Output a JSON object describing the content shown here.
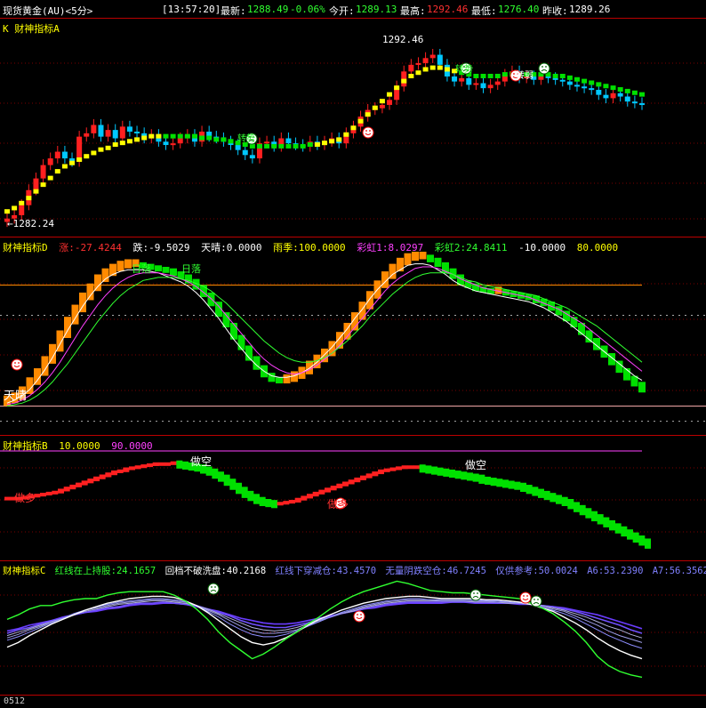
{
  "topbar": {
    "instrument": "现货黄金(AU)<5分>",
    "time": "[13:57:20]",
    "last_label": "最新:",
    "last_value": "1288.49",
    "change": "-0.06%",
    "open_label": "今开:",
    "open_value": "1289.13",
    "high_label": "最高:",
    "high_value": "1292.46",
    "low_label": "最低:",
    "low_value": "1276.40",
    "prev_label": "昨收:",
    "prev_value": "1289.26"
  },
  "pane_a": {
    "title": "K  财神指标A",
    "high_marker": "1292.46",
    "low_marker": "←1282.24",
    "signal_labels": [
      "转势",
      "转势",
      "转势",
      "转弱"
    ]
  },
  "pane_d": {
    "title": "财神指标D",
    "params": [
      {
        "text": "涨:-27.4244",
        "color": "#ff3030"
      },
      {
        "text": "跌:-9.5029",
        "color": "#ffffff"
      },
      {
        "text": "天晴:0.0000",
        "color": "#ffffff"
      },
      {
        "text": "雨季:100.0000",
        "color": "#ffff00"
      },
      {
        "text": "彩虹1:8.0297",
        "color": "#ff40ff"
      },
      {
        "text": "彩虹2:24.8411",
        "color": "#30ff30"
      },
      {
        "text": "-10.0000",
        "color": "#ffffff"
      },
      {
        "text": "80.0000",
        "color": "#ffff00"
      }
    ],
    "label_sunny": "天晴",
    "label_rain": "日落",
    "label_rain2": "日落"
  },
  "pane_b": {
    "title": "财神指标B",
    "params": [
      {
        "text": "10.0000",
        "color": "#ffff00"
      },
      {
        "text": "90.0000",
        "color": "#ff40ff"
      }
    ],
    "label_long": "做多",
    "label_short": "做空"
  },
  "pane_c": {
    "title": "财神指标C",
    "params": [
      {
        "text": "红线在上持股:24.1657",
        "color": "#30ff30"
      },
      {
        "text": "回档不破洗盘:40.2168",
        "color": "#ffffff"
      },
      {
        "text": "红线下穿减仓:43.4570",
        "color": "#8080ff"
      },
      {
        "text": "无量阴跌空仓:46.7245",
        "color": "#8080ff"
      },
      {
        "text": "仅供参考:50.0024",
        "color": "#8080ff"
      },
      {
        "text": "A6:53.2390",
        "color": "#8080ff"
      },
      {
        "text": "A7:56.3562",
        "color": "#8080ff"
      }
    ]
  },
  "bottom": {
    "code": "0512"
  },
  "colors": {
    "up": "#ff2020",
    "down": "#00c8ff",
    "yellow": "#ffff00",
    "green": "#00e000",
    "orange": "#ff8a00",
    "magenta": "#ff40ff",
    "purple": "#8040ff"
  },
  "chart_data": [
    {
      "type": "candlestick",
      "title": "K  财神指标A",
      "close": [
        1282.4,
        1282.6,
        1283.2,
        1284.1,
        1284.8,
        1285.6,
        1286.0,
        1286.4,
        1286.0,
        1285.8,
        1287.3,
        1287.5,
        1288.0,
        1287.3,
        1287.7,
        1287.2,
        1287.9,
        1287.6,
        1287.5,
        1287.2,
        1287.4,
        1287.0,
        1286.8,
        1286.9,
        1287.2,
        1287.4,
        1287.0,
        1287.6,
        1287.3,
        1287.2,
        1287.0,
        1286.8,
        1286.5,
        1286.2,
        1286.0,
        1286.9,
        1287.0,
        1286.7,
        1287.2,
        1286.9,
        1286.8,
        1286.7,
        1287.0,
        1286.8,
        1287.0,
        1287.2,
        1286.9,
        1287.5,
        1287.9,
        1288.5,
        1288.9,
        1289.0,
        1289.2,
        1289.5,
        1290.3,
        1291.2,
        1291.6,
        1291.7,
        1292.0,
        1292.2,
        1291.6,
        1290.9,
        1290.6,
        1290.8,
        1290.4,
        1290.5,
        1290.2,
        1290.4,
        1290.6,
        1291.0,
        1291.2,
        1290.8,
        1290.9,
        1290.7,
        1291.0,
        1290.8,
        1290.7,
        1290.6,
        1290.4,
        1290.3,
        1290.2,
        1290.1,
        1289.8,
        1289.6,
        1289.9,
        1289.7,
        1289.4,
        1289.3,
        1289.2
      ],
      "trail": [
        1282.8,
        1283.0,
        1283.3,
        1283.6,
        1284.0,
        1284.4,
        1284.8,
        1285.2,
        1285.5,
        1285.7,
        1285.9,
        1286.1,
        1286.3,
        1286.5,
        1286.6,
        1286.8,
        1286.9,
        1287.0,
        1287.1,
        1287.2,
        1287.3,
        1287.3,
        1287.3,
        1287.3,
        1287.3,
        1287.3,
        1287.3,
        1287.2,
        1287.2,
        1287.1,
        1287.1,
        1287.0,
        1286.9,
        1286.8,
        1286.7,
        1286.7,
        1286.7,
        1286.7,
        1286.7,
        1286.7,
        1286.7,
        1286.7,
        1286.8,
        1286.8,
        1286.9,
        1287.0,
        1287.1,
        1287.4,
        1287.8,
        1288.2,
        1288.6,
        1289.0,
        1289.4,
        1289.8,
        1290.2,
        1290.6,
        1290.9,
        1291.1,
        1291.3,
        1291.4,
        1291.4,
        1291.3,
        1291.2,
        1291.1,
        1291.0,
        1290.9,
        1290.9,
        1290.9,
        1290.9,
        1291.0,
        1291.0,
        1291.0,
        1291.0,
        1291.0,
        1291.0,
        1291.0,
        1290.9,
        1290.9,
        1290.8,
        1290.7,
        1290.6,
        1290.5,
        1290.4,
        1290.3,
        1290.2,
        1290.1,
        1290.0,
        1289.9,
        1289.8
      ],
      "ylim": [
        1281.8,
        1293.4
      ],
      "high_marker": 1292.46,
      "low_marker": 1282.24
    },
    {
      "type": "bar",
      "title": "财神指标D",
      "values": [
        2,
        4,
        8,
        14,
        20,
        28,
        36,
        45,
        54,
        62,
        70,
        76,
        82,
        86,
        89,
        91,
        92,
        92,
        91,
        90,
        89,
        88,
        86,
        84,
        81,
        77,
        72,
        66,
        59,
        52,
        44,
        37,
        30,
        24,
        19,
        16,
        15,
        16,
        18,
        21,
        25,
        29,
        33,
        38,
        44,
        50,
        57,
        64,
        71,
        78,
        84,
        89,
        93,
        96,
        97,
        97,
        95,
        92,
        88,
        84,
        80,
        78,
        76,
        75,
        74,
        74,
        73,
        72,
        71,
        70,
        68,
        66,
        63,
        60,
        56,
        52,
        47,
        42,
        37,
        32,
        27,
        22,
        17,
        13,
        9
      ],
      "line1": [
        2,
        4,
        7,
        11,
        17,
        24,
        32,
        41,
        50,
        58,
        66,
        73,
        79,
        84,
        87,
        89,
        90,
        90,
        90,
        89,
        88,
        86,
        84,
        82,
        79,
        75,
        70,
        64,
        58,
        51,
        44,
        38,
        32,
        27,
        23,
        20,
        19,
        19,
        20,
        22,
        25,
        29,
        34,
        39,
        45,
        51,
        58,
        64,
        71,
        77,
        82,
        87,
        90,
        93,
        94,
        94,
        93,
        90,
        87,
        83,
        80,
        78,
        76,
        75,
        74,
        73,
        72,
        71,
        70,
        69,
        67,
        65,
        62,
        59,
        56,
        52,
        48,
        44,
        40,
        36,
        32,
        28,
        24,
        20,
        17
      ],
      "line2": [
        1,
        2,
        4,
        7,
        11,
        16,
        22,
        29,
        37,
        45,
        53,
        60,
        67,
        73,
        78,
        82,
        85,
        87,
        88,
        88,
        88,
        87,
        86,
        84,
        82,
        79,
        75,
        71,
        66,
        60,
        54,
        48,
        42,
        36,
        31,
        27,
        24,
        22,
        21,
        22,
        24,
        27,
        31,
        35,
        40,
        46,
        52,
        58,
        64,
        70,
        76,
        81,
        85,
        88,
        91,
        92,
        92,
        91,
        89,
        87,
        84,
        82,
        80,
        78,
        77,
        76,
        75,
        74,
        73,
        72,
        70,
        68,
        66,
        64,
        61,
        58,
        55,
        51,
        47,
        43,
        39,
        35,
        31,
        27,
        23
      ],
      "line3": [
        0,
        1,
        2,
        4,
        7,
        11,
        16,
        22,
        28,
        35,
        42,
        49,
        56,
        62,
        68,
        73,
        77,
        80,
        83,
        84,
        85,
        85,
        85,
        84,
        83,
        81,
        79,
        76,
        72,
        68,
        63,
        58,
        53,
        48,
        43,
        39,
        35,
        32,
        30,
        29,
        29,
        30,
        32,
        35,
        39,
        43,
        48,
        53,
        59,
        64,
        69,
        74,
        78,
        82,
        85,
        87,
        88,
        88,
        88,
        87,
        85,
        83,
        82,
        80,
        79,
        78,
        77,
        76,
        75,
        74,
        73,
        71,
        69,
        67,
        65,
        62,
        59,
        56,
        53,
        49,
        45,
        41,
        37,
        33,
        29
      ],
      "ylim": [
        -12,
        102
      ],
      "ref_lines": [
        0,
        80,
        100,
        -10
      ]
    },
    {
      "type": "bar",
      "title": "财神指标B",
      "values": [
        53,
        53,
        53,
        54,
        55,
        56,
        57,
        58,
        59,
        61,
        63,
        65,
        67,
        69,
        71,
        73,
        75,
        77,
        79,
        80,
        82,
        83,
        84,
        85,
        86,
        87,
        87,
        87,
        88,
        87,
        86,
        85,
        84,
        82,
        80,
        77,
        74,
        70,
        66,
        62,
        58,
        55,
        52,
        50,
        49,
        48,
        48,
        49,
        50,
        52,
        54,
        56,
        58,
        60,
        62,
        64,
        66,
        68,
        70,
        72,
        74,
        76,
        78,
        80,
        81,
        82,
        83,
        84,
        84,
        84,
        83,
        82,
        81,
        80,
        79,
        78,
        77,
        76,
        75,
        74,
        72,
        71,
        70,
        69,
        68,
        67,
        66,
        64,
        62,
        60,
        58,
        56,
        54,
        52,
        50,
        47,
        44,
        41,
        38,
        35,
        32,
        29,
        26,
        23,
        20,
        17,
        14,
        11,
        8
      ],
      "ylim": [
        0,
        100
      ],
      "ref_lines": [
        10,
        90
      ]
    },
    {
      "type": "line",
      "title": "财神指标C",
      "series": [
        {
          "name": "红线在上持股",
          "values": [
            62,
            66,
            71,
            74,
            74,
            77,
            79,
            80,
            80,
            83,
            85,
            86,
            86,
            86,
            86,
            83,
            78,
            71,
            62,
            51,
            42,
            35,
            28,
            32,
            38,
            45,
            51,
            58,
            64,
            71,
            77,
            82,
            86,
            89,
            92,
            95,
            93,
            90,
            87,
            86,
            85,
            85,
            84,
            83,
            82,
            81,
            80,
            76,
            72,
            67,
            60,
            52,
            42,
            30,
            22,
            17,
            14,
            12
          ]
        },
        {
          "name": "回档不破洗盘",
          "values": [
            38,
            42,
            48,
            53,
            58,
            62,
            66,
            70,
            73,
            76,
            78,
            80,
            81,
            82,
            82,
            81,
            78,
            74,
            68,
            61,
            54,
            47,
            42,
            40,
            42,
            46,
            51,
            57,
            62,
            66,
            70,
            73,
            76,
            78,
            80,
            81,
            82,
            82,
            81,
            80,
            80,
            80,
            80,
            79,
            79,
            78,
            77,
            75,
            72,
            69,
            64,
            59,
            53,
            46,
            40,
            35,
            31,
            28
          ]
        },
        {
          "name": "红线下穿减仓",
          "values": [
            44,
            47,
            51,
            55,
            59,
            63,
            67,
            70,
            73,
            75,
            77,
            78,
            79,
            80,
            80,
            79,
            77,
            74,
            69,
            64,
            58,
            53,
            49,
            47,
            47,
            49,
            52,
            56,
            60,
            64,
            68,
            71,
            74,
            76,
            78,
            79,
            80,
            80,
            79,
            79,
            79,
            79,
            79,
            78,
            78,
            77,
            76,
            75,
            73,
            70,
            67,
            63,
            58,
            53,
            48,
            44,
            40,
            37
          ]
        },
        {
          "name": "无量阴跌空仓",
          "values": [
            46,
            49,
            53,
            56,
            60,
            63,
            67,
            70,
            72,
            74,
            76,
            77,
            78,
            79,
            79,
            78,
            77,
            74,
            70,
            66,
            61,
            56,
            52,
            50,
            50,
            51,
            53,
            57,
            60,
            64,
            67,
            70,
            73,
            75,
            77,
            78,
            79,
            79,
            79,
            78,
            78,
            78,
            78,
            78,
            77,
            77,
            76,
            75,
            74,
            71,
            69,
            65,
            61,
            57,
            52,
            48,
            45,
            42
          ]
        },
        {
          "name": "仅供参考",
          "values": [
            48,
            51,
            54,
            57,
            60,
            63,
            66,
            69,
            71,
            73,
            75,
            76,
            77,
            78,
            78,
            77,
            76,
            74,
            71,
            67,
            63,
            59,
            55,
            53,
            52,
            53,
            55,
            58,
            61,
            64,
            67,
            69,
            72,
            74,
            76,
            77,
            78,
            78,
            78,
            78,
            78,
            78,
            77,
            77,
            77,
            76,
            76,
            75,
            74,
            72,
            70,
            67,
            64,
            60,
            56,
            53,
            49,
            46
          ]
        },
        {
          "name": "A6",
          "values": [
            50,
            53,
            55,
            58,
            61,
            63,
            66,
            68,
            70,
            72,
            73,
            75,
            76,
            76,
            77,
            76,
            75,
            74,
            71,
            68,
            65,
            61,
            58,
            56,
            55,
            55,
            57,
            59,
            62,
            64,
            67,
            69,
            71,
            73,
            75,
            76,
            77,
            77,
            77,
            77,
            77,
            77,
            77,
            77,
            76,
            76,
            76,
            75,
            74,
            73,
            71,
            69,
            66,
            63,
            60,
            57,
            53,
            50
          ]
        },
        {
          "name": "A7",
          "values": [
            52,
            54,
            57,
            59,
            61,
            64,
            66,
            68,
            69,
            71,
            72,
            74,
            75,
            75,
            76,
            76,
            75,
            73,
            71,
            69,
            66,
            63,
            61,
            59,
            58,
            58,
            59,
            61,
            63,
            65,
            67,
            69,
            71,
            72,
            74,
            75,
            76,
            76,
            76,
            76,
            77,
            77,
            76,
            76,
            76,
            76,
            75,
            75,
            74,
            73,
            72,
            70,
            68,
            66,
            63,
            60,
            57,
            54
          ]
        }
      ],
      "ylim": [
        0,
        100
      ]
    }
  ]
}
